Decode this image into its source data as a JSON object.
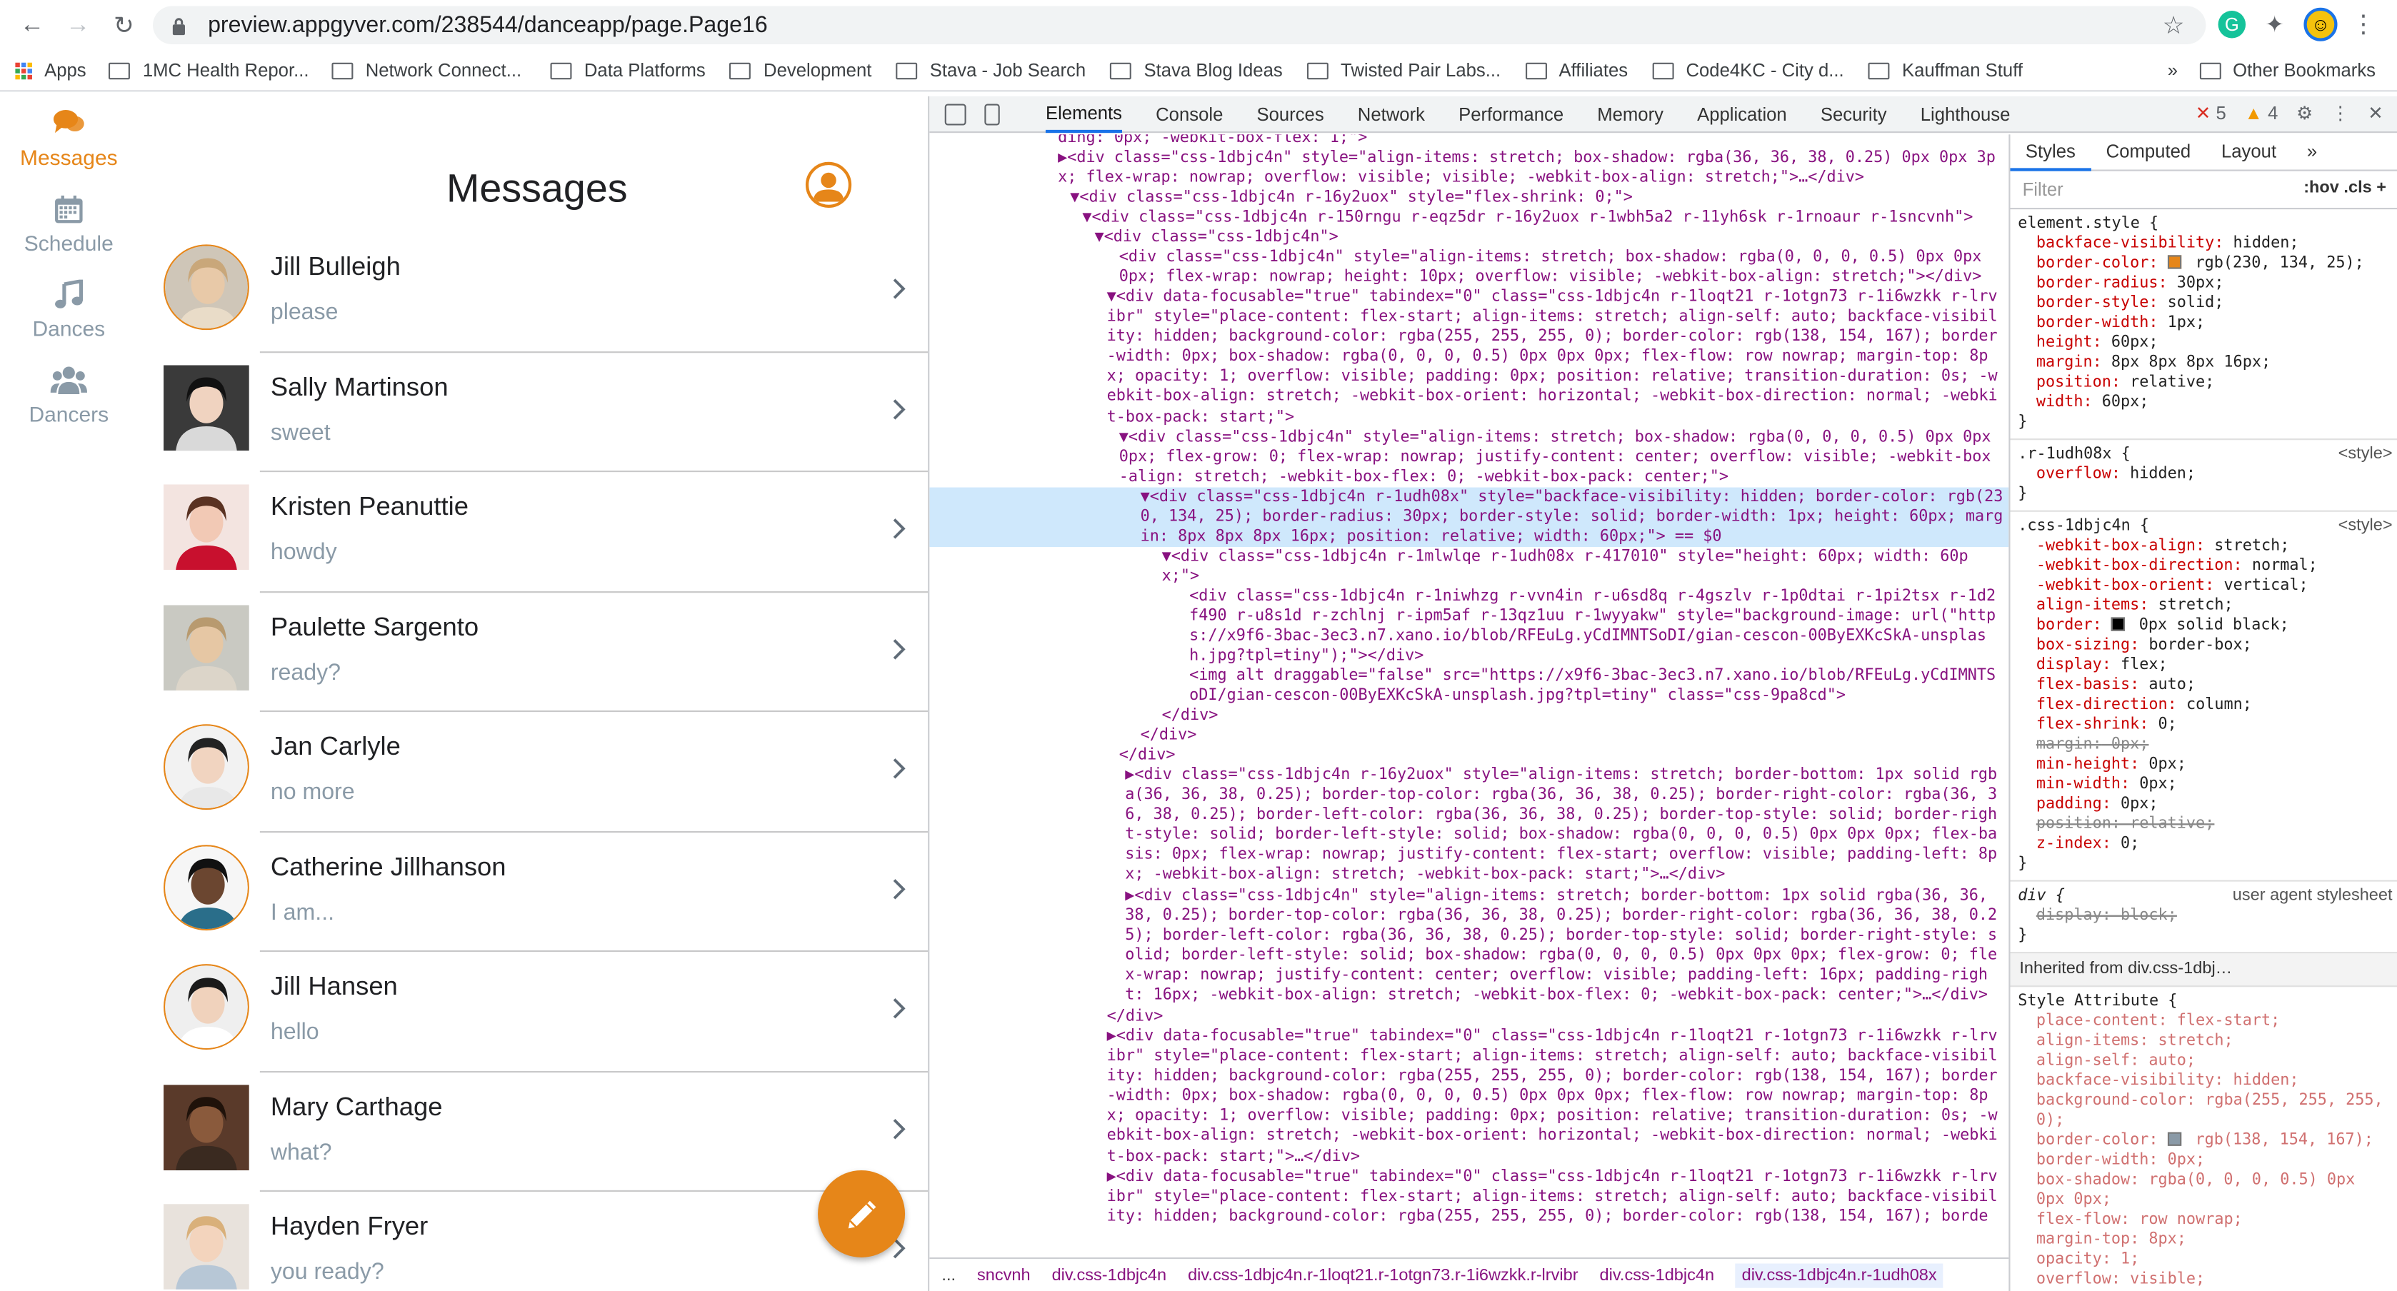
{
  "browser": {
    "url": "preview.appgyver.com/238544/danceapp/page.Page16",
    "bookmarks": [
      "Apps",
      "1MC Health Repor...",
      "Network Connect...",
      "Data Platforms",
      "Development",
      "Stava - Job Search",
      "Stava Blog Ideas",
      "Twisted Pair Labs...",
      "Affiliates",
      "Code4KC - City d...",
      "Kauffman Stuff"
    ],
    "other_bookmarks": "Other Bookmarks",
    "overflow": "»"
  },
  "app": {
    "accent": "#e68619",
    "nav": [
      {
        "label": "Messages",
        "icon": "chat-icon",
        "active": true
      },
      {
        "label": "Schedule",
        "icon": "calendar-icon",
        "active": false
      },
      {
        "label": "Dances",
        "icon": "music-note-icon",
        "active": false
      },
      {
        "label": "Dancers",
        "icon": "users-icon",
        "active": false
      }
    ],
    "title": "Messages",
    "conversations": [
      {
        "name": "Jill Bulleigh",
        "message": "please"
      },
      {
        "name": "Sally Martinson",
        "message": "sweet"
      },
      {
        "name": "Kristen Peanuttie",
        "message": "howdy"
      },
      {
        "name": "Paulette Sargento",
        "message": "ready?"
      },
      {
        "name": "Jan Carlyle",
        "message": "no more"
      },
      {
        "name": "Catherine Jillhanson",
        "message": "I am..."
      },
      {
        "name": "Jill Hansen",
        "message": "hello"
      },
      {
        "name": "Mary Carthage",
        "message": "what?"
      },
      {
        "name": "Hayden Fryer",
        "message": "you ready?"
      }
    ]
  },
  "devtools": {
    "tabs": [
      "Elements",
      "Console",
      "Sources",
      "Network",
      "Performance",
      "Memory",
      "Application",
      "Security",
      "Lighthouse"
    ],
    "errors": "5",
    "warnings": "4",
    "code_lines": [
      "ding: 0px; -webkit-box-flex: 1;\">",
      "▶<div class=\"css-1dbjc4n\" style=\"align-items: stretch; box-shadow: rgba(36, 36, 38, 0.25) 0px 0px 3px; flex-wrap: nowrap; overflow: visible; visible; -webkit-box-align: stretch;\">…</div>",
      "▼<div class=\"css-1dbjc4n r-16y2uox\" style=\"flex-shrink: 0;\">",
      "▼<div class=\"css-1dbjc4n r-150rngu r-eqz5dr r-16y2uox r-1wbh5a2 r-11yh6sk r-1rnoaur r-1sncvnh\">",
      "▼<div class=\"css-1dbjc4n\">",
      "<div class=\"css-1dbjc4n\" style=\"align-items: stretch; box-shadow: rgba(0, 0, 0, 0.5) 0px 0px 0px; flex-wrap: nowrap; height: 10px; overflow: visible; -webkit-box-align: stretch;\"></div>",
      "▼<div data-focusable=\"true\" tabindex=\"0\" class=\"css-1dbjc4n r-1loqt21 r-1otgn73 r-1i6wzkk r-lrvibr\" style=\"place-content: flex-start; align-items: stretch; align-self: auto; backface-visibility: hidden; background-color: rgba(255, 255, 255, 0); border-color: rgb(138, 154, 167); border-width: 0px; box-shadow: rgba(0, 0, 0, 0.5) 0px 0px 0px; flex-flow: row nowrap; margin-top: 8px; opacity: 1; overflow: visible; padding: 0px; position: relative; transition-duration: 0s; -webkit-box-align: stretch; -webkit-box-orient: horizontal; -webkit-box-direction: normal; -webkit-box-pack: start;\">",
      "▼<div class=\"css-1dbjc4n\" style=\"align-items: stretch; box-shadow: rgba(0, 0, 0, 0.5) 0px 0px 0px; flex-grow: 0; flex-wrap: nowrap; justify-content: center; overflow: visible; -webkit-box-align: stretch; -webkit-box-flex: 0; -webkit-box-pack: center;\">",
      "▼<div class=\"css-1dbjc4n r-1udh08x\" style=\"backface-visibility: hidden; border-color: rgb(230, 134, 25); border-radius: 30px; border-style: solid; border-width: 1px; height: 60px; margin: 8px 8px 8px 16px; position: relative; width: 60px;\"> == $0",
      "▼<div class=\"css-1dbjc4n r-1mlwlqe r-1udh08x r-417010\" style=\"height: 60px; width: 60px;\">",
      "<div class=\"css-1dbjc4n r-1niwhzg r-vvn4in r-u6sd8q r-4gszlv r-1p0dtai r-1pi2tsx r-1d2f490 r-u8s1d r-zchlnj r-ipm5af r-13qz1uu r-1wyyakw\" style=\"background-image: url(\"https://x9f6-3bac-3ec3.n7.xano.io/blob/RFEuLg.yCdIMNTSoDI/gian-cescon-00ByEXKcSkA-unsplash.jpg?tpl=tiny\");\"></div>",
      "<img alt draggable=\"false\" src=\"https://x9f6-3bac-3ec3.n7.xano.io/blob/RFEuLg.yCdIMNTSoDI/gian-cescon-00ByEXKcSkA-unsplash.jpg?tpl=tiny\" class=\"css-9pa8cd\">",
      "</div>",
      "</div>",
      "</div>",
      "▶<div class=\"css-1dbjc4n r-16y2uox\" style=\"align-items: stretch; border-bottom: 1px solid rgba(36, 36, 38, 0.25); border-top-color: rgba(36, 36, 38, 0.25); border-right-color: rgba(36, 36, 38, 0.25); border-left-color: rgba(36, 36, 38, 0.25); border-top-style: solid; border-right-style: solid; border-left-style: solid; box-shadow: rgba(0, 0, 0, 0.5) 0px 0px 0px; flex-basis: 0px; flex-wrap: nowrap; justify-content: flex-start; overflow: visible; padding-left: 8px; -webkit-box-align: stretch; -webkit-box-pack: start;\">…</div>",
      "▶<div class=\"css-1dbjc4n\" style=\"align-items: stretch; border-bottom: 1px solid rgba(36, 36, 38, 0.25); border-top-color: rgba(36, 36, 38, 0.25); border-right-color: rgba(36, 36, 38, 0.25); border-left-color: rgba(36, 36, 38, 0.25); border-top-style: solid; border-right-style: solid; border-left-style: solid; box-shadow: rgba(0, 0, 0, 0.5) 0px 0px 0px; flex-grow: 0; flex-wrap: nowrap; justify-content: center; overflow: visible; padding-left: 16px; padding-right: 16px; -webkit-box-align: stretch; -webkit-box-flex: 0; -webkit-box-pack: center;\">…</div>",
      "</div>",
      "▶<div data-focusable=\"true\" tabindex=\"0\" class=\"css-1dbjc4n r-1loqt21 r-1otgn73 r-1i6wzkk r-lrvibr\" style=\"place-content: flex-start; align-items: stretch; align-self: auto; backface-visibility: hidden; background-color: rgba(255, 255, 255, 0); border-color: rgb(138, 154, 167); border-width: 0px; box-shadow: rgba(0, 0, 0, 0.5) 0px 0px 0px; flex-flow: row nowrap; margin-top: 8px; opacity: 1; overflow: visible; padding: 0px; position: relative; transition-duration: 0s; -webkit-box-align: stretch; -webkit-box-orient: horizontal; -webkit-box-direction: normal; -webkit-box-pack: start;\">…</div>",
      "▶<div data-focusable=\"true\" tabindex=\"0\" class=\"css-1dbjc4n r-1loqt21 r-1otgn73 r-1i6wzkk r-lrvibr\" style=\"place-content: flex-start; align-items: stretch; align-self: auto; backface-visibility: hidden; background-color: rgba(255, 255, 255, 0); border-color: rgb(138, 154, 167); borde"
    ],
    "breadcrumbs": [
      "...",
      "sncvnh",
      "div.css-1dbjc4n",
      "div.css-1dbjc4n.r-1loqt21.r-1otgn73.r-1i6wzkk.r-lrvibr",
      "div.css-1dbjc4n",
      "div.css-1dbjc4n.r-1udh08x"
    ],
    "styles_tabs": [
      "Styles",
      "Computed",
      "Layout",
      "»"
    ],
    "filter_placeholder": "Filter",
    "filter_options": ":hov .cls +",
    "element_style": {
      "selector": "element.style {",
      "props": [
        "backface-visibility: hidden;",
        "border-color: rgb(230, 134, 25);",
        "border-radius: 30px;",
        "border-style: solid;",
        "border-width: 1px;",
        "height: 60px;",
        "margin: 8px 8px 8px 16px;",
        "position: relative;",
        "width: 60px;"
      ]
    },
    "rule_r1udh08x": {
      "selector": ".r-1udh08x {",
      "source": "<style>",
      "props": [
        "overflow: hidden;"
      ]
    },
    "rule_css": {
      "selector": ".css-1dbjc4n {",
      "source": "<style>",
      "props": [
        "-webkit-box-align: stretch;",
        "-webkit-box-direction: normal;",
        "-webkit-box-orient: vertical;",
        "align-items: stretch;",
        "border: 0px solid black;",
        "box-sizing: border-box;",
        "display: flex;",
        "flex-basis: auto;",
        "flex-direction: column;",
        "flex-shrink: 0;",
        "margin: 0px;",
        "min-height: 0px;",
        "min-width: 0px;",
        "padding: 0px;",
        "position: relative;",
        "z-index: 0;"
      ]
    },
    "rule_div": {
      "selector": "div {",
      "source": "user agent stylesheet",
      "props": [
        "display: block;"
      ]
    },
    "inherited": "Inherited from div.css-1dbj…",
    "style_attribute": {
      "selector": "Style Attribute {",
      "props": [
        "place-content: flex-start;",
        "align-items: stretch;",
        "align-self: auto;",
        "backface-visibility: hidden;",
        "background-color: rgba(255, 255, 255, 0);",
        "border-color: rgb(138, 154, 167);",
        "border-width: 0px;",
        "box-shadow: rgba(0, 0, 0, 0.5) 0px 0px 0px;",
        "flex-flow: row nowrap;",
        "margin-top: 8px;",
        "opacity: 1;",
        "overflow: visible;"
      ]
    }
  }
}
